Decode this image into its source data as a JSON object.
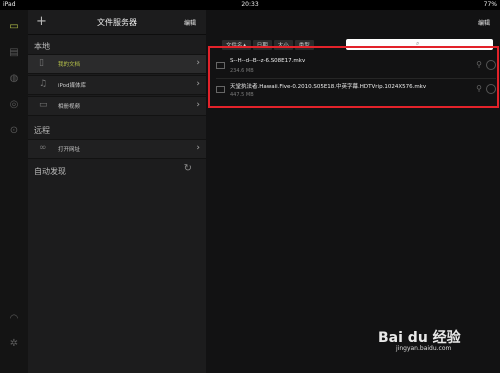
{
  "statusbar": {
    "device": "iPad",
    "time": "20:33",
    "battery": "77%"
  },
  "rail": {
    "icons": [
      "folder-icon",
      "document-icon",
      "globe-icon",
      "compass-icon",
      "download-icon",
      "wifi-icon",
      "settings-icon"
    ]
  },
  "sidebar": {
    "add_label": "+",
    "title": "文件服务器",
    "edit_label": "编辑",
    "local_section": "本地",
    "items": [
      {
        "label": "我的文档",
        "icon": "document-icon"
      },
      {
        "label": "iPod媒体库",
        "icon": "music-note-icon"
      },
      {
        "label": "相册视频",
        "icon": "video-icon"
      }
    ],
    "remote_section": "远程",
    "remote_items": [
      {
        "label": "打开网址",
        "icon": "link-icon"
      }
    ],
    "auto_discover": "自动发现"
  },
  "main": {
    "edit_label": "编辑",
    "tabs": [
      "文件名▲",
      "日期",
      "大小",
      "类型"
    ],
    "files": [
      {
        "name": "S--H--d--B--z-6.S08E17.mkv",
        "size": "234.6 MB"
      },
      {
        "name": "天堂执法者.Hawaii.Five-0.2010.S05E18.中英字幕.HDTVrip.1024X576.mkv",
        "size": "447.5 MB"
      }
    ]
  },
  "watermark": {
    "brand": "Bai du 经验",
    "sub": "jingyan.baidu.com"
  },
  "colors": {
    "highlight": "#e2222a",
    "selected_label": "#b6c24a",
    "background": "#0f0f10"
  }
}
